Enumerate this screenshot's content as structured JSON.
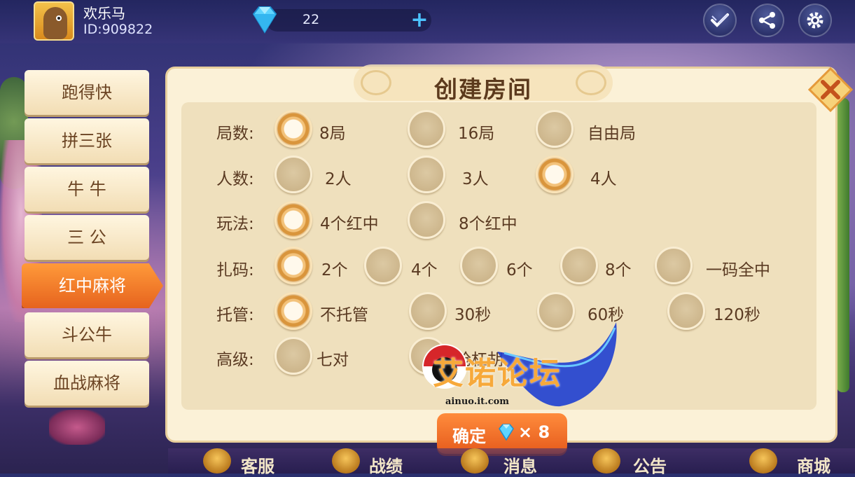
{
  "user": {
    "name": "欢乐马",
    "id_label": "ID:909822"
  },
  "currency": {
    "gems": "22",
    "plus_label": "+"
  },
  "top_actions": [
    {
      "icon": "checklist-icon"
    },
    {
      "icon": "share-icon"
    },
    {
      "icon": "gear-icon"
    }
  ],
  "menu": {
    "items": [
      {
        "label": "跑得快"
      },
      {
        "label": "拼三张"
      },
      {
        "label": "牛 牛"
      },
      {
        "label": "三 公"
      },
      {
        "label": "红中麻将",
        "active": true
      },
      {
        "label": "斗公牛"
      },
      {
        "label": "血战麻将"
      }
    ]
  },
  "dialog": {
    "title": "创建房间",
    "close_icon": "close-icon",
    "rows": [
      {
        "label": "局数:",
        "options": [
          {
            "label": "8局",
            "selected": true
          },
          {
            "label": "16局",
            "selected": false
          },
          {
            "label": "自由局",
            "selected": false
          }
        ]
      },
      {
        "label": "人数:",
        "options": [
          {
            "label": "2人",
            "selected": false
          },
          {
            "label": "3人",
            "selected": false
          },
          {
            "label": "4人",
            "selected": true
          }
        ]
      },
      {
        "label": "玩法:",
        "options": [
          {
            "label": "4个红中",
            "selected": true
          },
          {
            "label": "8个红中",
            "selected": false
          }
        ]
      },
      {
        "label": "扎码:",
        "options": [
          {
            "label": "2个",
            "selected": true
          },
          {
            "label": "4个",
            "selected": false
          },
          {
            "label": "6个",
            "selected": false
          },
          {
            "label": "8个",
            "selected": false
          },
          {
            "label": "一码全中",
            "selected": false
          }
        ]
      },
      {
        "label": "托管:",
        "options": [
          {
            "label": "不托管",
            "selected": true
          },
          {
            "label": "30秒",
            "selected": false
          },
          {
            "label": "60秒",
            "selected": false
          },
          {
            "label": "120秒",
            "selected": false
          }
        ]
      },
      {
        "label": "高级:",
        "options": [
          {
            "label": "七对",
            "selected": false
          },
          {
            "label": "抢杠胡",
            "selected": false
          }
        ]
      }
    ],
    "confirm": {
      "label": "确定",
      "multiplier": "× 8"
    }
  },
  "bottom_nav": [
    {
      "label": "客服"
    },
    {
      "label": "战绩"
    },
    {
      "label": "消息"
    },
    {
      "label": "公告"
    },
    {
      "label": "商城"
    }
  ],
  "watermark": {
    "text": "艾诺论坛",
    "url": "ainuo.it.com"
  },
  "colors": {
    "accent": "#ff8c3c",
    "panel": "#fbf1d7",
    "text_brown": "#5a3a22",
    "gem_blue": "#4cc3ff"
  }
}
